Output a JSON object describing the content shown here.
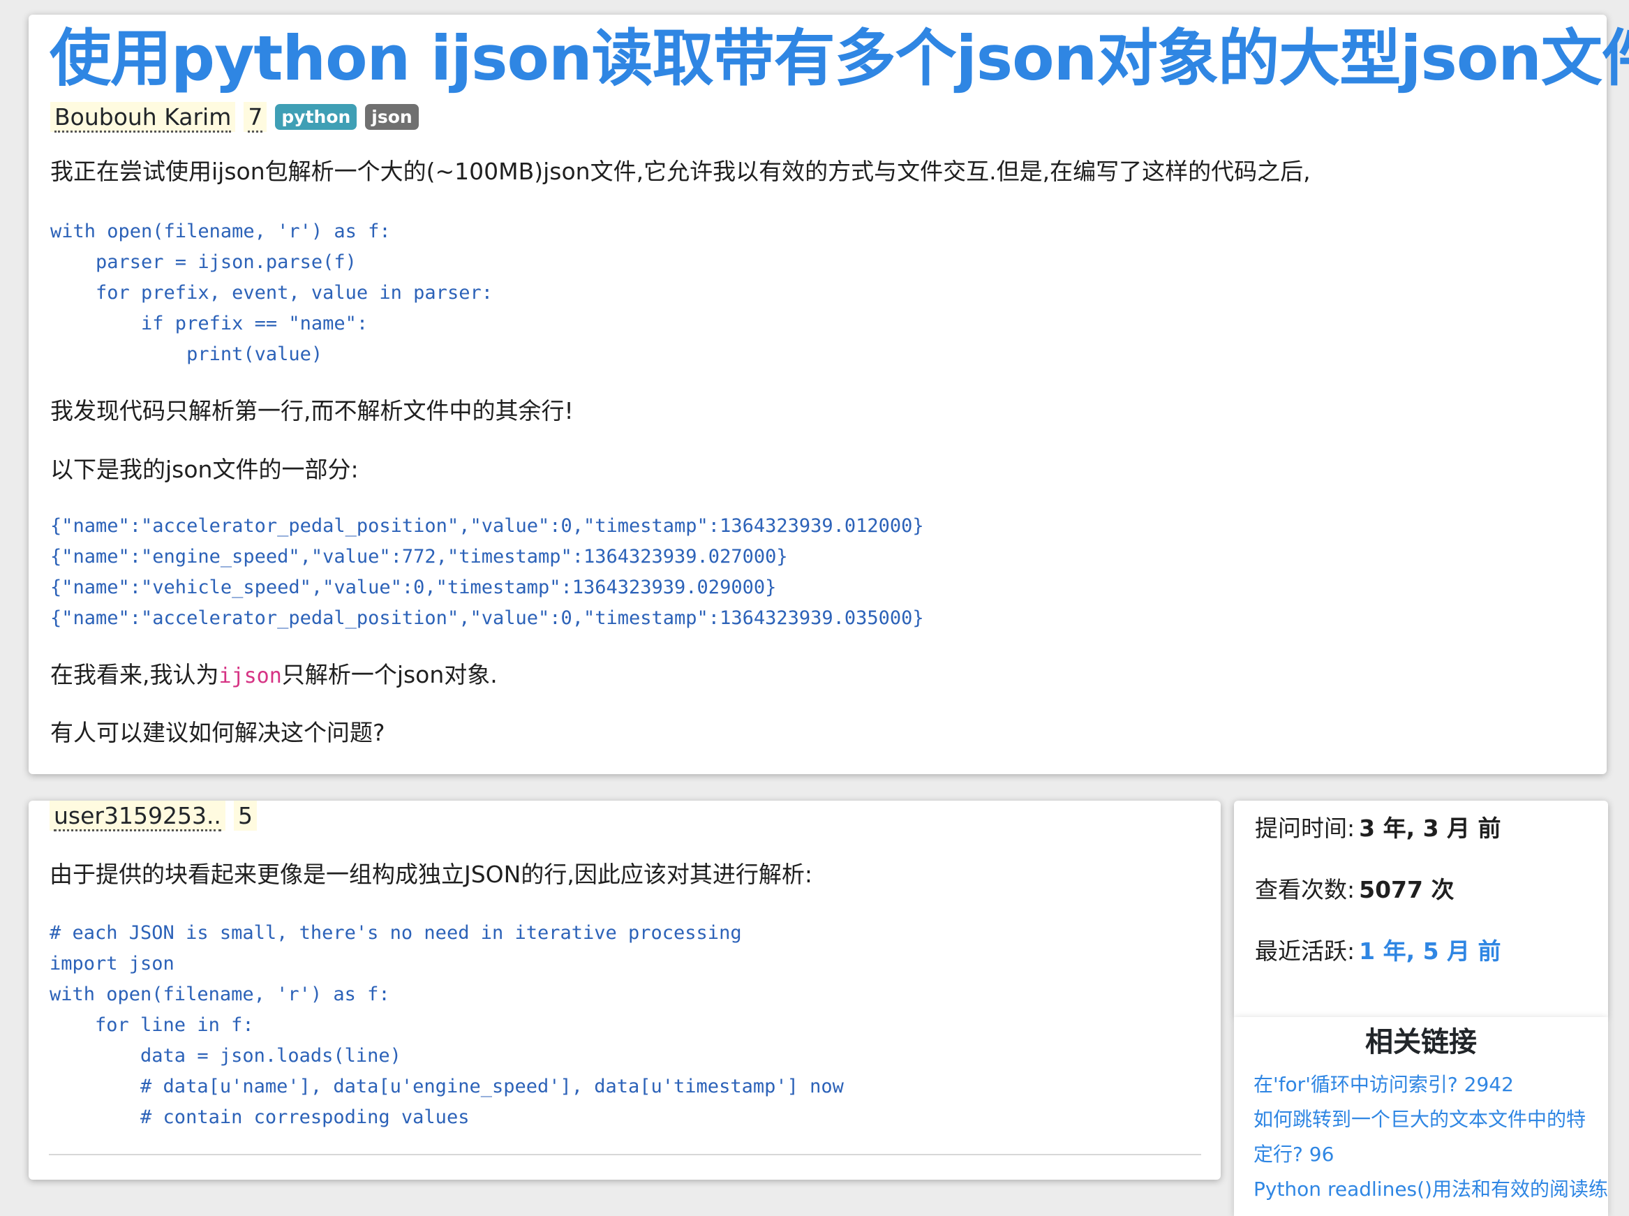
{
  "question": {
    "title": "使用python ijson读取带有多个json对象的大型json文件",
    "author": "Boubouh Karim",
    "score": "7",
    "tags": [
      "python",
      "json"
    ],
    "intro": "我正在尝试使用ijson包解析一个大的(~100MB)json文件,它允许我以有效的方式与文件交互.但是,在编写了这样的代码之后,",
    "code1": [
      "with open(filename, 'r') as f:",
      "    parser = ijson.parse(f)",
      "    for prefix, event, value in parser:",
      "        if prefix == \"name\":",
      "            print(value)"
    ],
    "p2": "我发现代码只解析第一行,而不解析文件中的其余行!",
    "p3": "以下是我的json文件的一部分:",
    "code2": [
      "{\"name\":\"accelerator_pedal_position\",\"value\":0,\"timestamp\":1364323939.012000}",
      "{\"name\":\"engine_speed\",\"value\":772,\"timestamp\":1364323939.027000}",
      "{\"name\":\"vehicle_speed\",\"value\":0,\"timestamp\":1364323939.029000}",
      "{\"name\":\"accelerator_pedal_position\",\"value\":0,\"timestamp\":1364323939.035000}"
    ],
    "p4_before": "在我看来,我认为",
    "p4_code": "ijson",
    "p4_after": "只解析一个json对象.",
    "p5": "有人可以建议如何解决这个问题?"
  },
  "answer": {
    "author": "user3159253..",
    "score": "5",
    "intro": "由于提供的块看起来更像是一组构成独立JSON的行,因此应该对其进行解析:",
    "code": [
      "# each JSON is small, there's no need in iterative processing",
      "import json",
      "with open(filename, 'r') as f:",
      "    for line in f:",
      "        data = json.loads(line)",
      "        # data[u'name'], data[u'engine_speed'], data[u'timestamp'] now",
      "        # contain correspoding values"
    ]
  },
  "stats": {
    "asked_label": "提问时间:",
    "asked_value": "3 年, 3 月 前",
    "views_label": "查看次数:",
    "views_value": "5077 次",
    "active_label": "最近活跃:",
    "active_value": "1 年, 5 月 前"
  },
  "related": {
    "title": "相关链接",
    "links": [
      "在'for'循环中访问索引? 2942",
      "如何跳转到一个巨大的文本文件中的特",
      "定行? 96",
      "Python readlines()用法和有效的阅读练"
    ]
  }
}
